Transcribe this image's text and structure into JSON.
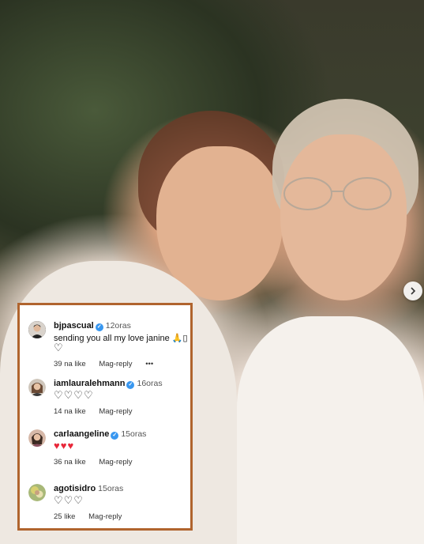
{
  "photo": {
    "next_icon": "chevron-right-icon"
  },
  "comments": [
    {
      "username": "bjpascual",
      "time": "12oras",
      "text": "sending you all my love janine 🙏▯",
      "text_line2": "♡",
      "likes": "39 na like",
      "reply": "Mag-reply",
      "more": "•••"
    },
    {
      "username": "iamlauralehmann",
      "time": "16oras",
      "text": "♡♡♡♡",
      "likes": "14 na like",
      "reply": "Mag-reply"
    },
    {
      "username": "carlaangeline",
      "time": "15oras",
      "text": "♥♥♥",
      "likes": "36 na like",
      "reply": "Mag-reply"
    },
    {
      "username": "agotisidro",
      "time": "15oras",
      "text": "♡♡♡",
      "likes": "25 like",
      "reply": "Mag-reply"
    }
  ],
  "colors": {
    "verified": "#3897f0",
    "frame": "#b0642e",
    "heart_red": "#e8283a"
  }
}
